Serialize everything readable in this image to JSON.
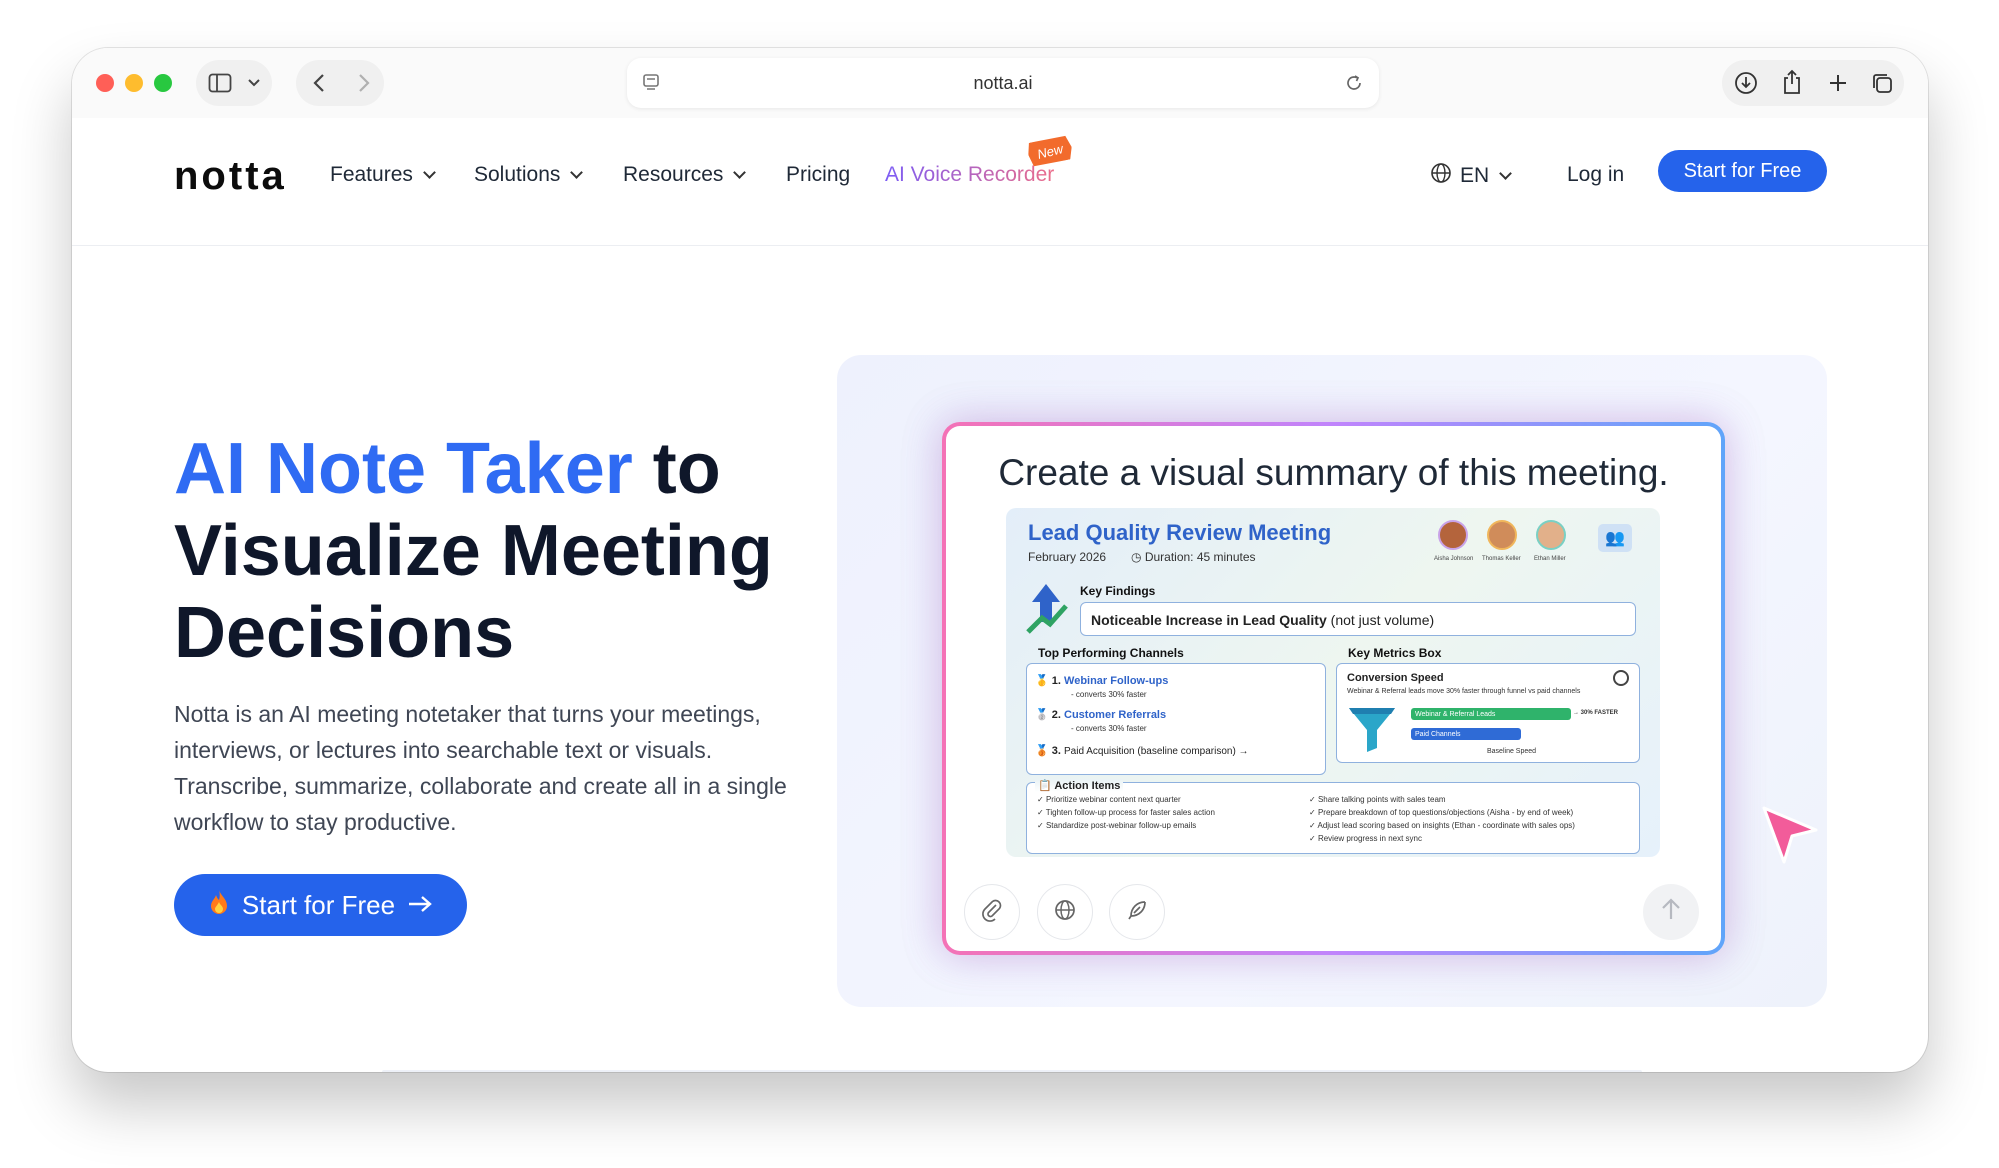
{
  "browser": {
    "url": "notta.ai",
    "colors": {
      "close": "#ff5f57",
      "minimize": "#febc2e",
      "zoom": "#28c840"
    },
    "icons": [
      "sidebar-icon",
      "chevron-down-icon",
      "back-icon",
      "forward-icon",
      "page-icon",
      "reload-icon",
      "download-icon",
      "share-icon",
      "new-tab-icon",
      "tab-overview-icon"
    ]
  },
  "nav": {
    "logo": "notta",
    "items": [
      {
        "label": "Features"
      },
      {
        "label": "Solutions"
      },
      {
        "label": "Resources"
      },
      {
        "label": "Pricing"
      }
    ],
    "voice_recorder": "AI Voice Recorder",
    "new_badge": "New",
    "language": "EN",
    "login": "Log in",
    "cta": "Start for Free",
    "accent": "#2563eb"
  },
  "hero": {
    "title_highlight": "AI Note Taker",
    "title_rest_1": " to",
    "title_line2": "Visualize Meeting",
    "title_line3": "Decisions",
    "description": "Notta is an AI meeting notetaker that turns your meetings, interviews, or lectures into searchable text or visuals. Transcribe, summarize, collaborate and create all in a single workflow to stay productive.",
    "cta": "Start for Free",
    "cta_icon": "fire-icon"
  },
  "demo": {
    "prompt": "Create a visual summary of this meeting.",
    "summary": {
      "title": "Lead Quality Review Meeting",
      "date": "February 2026",
      "duration": "Duration: 45 minutes",
      "attendees": [
        "Aisha Johnson",
        "Thomas Keller",
        "Ethan Miller"
      ],
      "key_findings_label": "Key Findings",
      "finding_bold": "Noticeable Increase in Lead Quality",
      "finding_rest": " (not just volume)",
      "channels_label": "Top Performing Channels",
      "channels": [
        {
          "rank": "1.",
          "name": "Webinar Follow-ups",
          "note": "- converts 30% faster"
        },
        {
          "rank": "2.",
          "name": "Customer Referrals",
          "note": "- converts 30% faster"
        },
        {
          "rank": "3.",
          "name": "Paid Acquisition (baseline comparison) →",
          "note": ""
        }
      ],
      "metrics_label": "Key Metrics Box",
      "metric_title": "Conversion Speed",
      "metric_desc": "Webinar & Referral leads move 30% faster through funnel vs paid channels",
      "bar1": "Webinar & Referral Leads",
      "bar1_tag": "→ 30% FASTER",
      "bar1_fraction": 0.9,
      "bar2": "Paid Channels",
      "bar2_fraction": 0.62,
      "baseline": "Baseline Speed",
      "actions_label": "Action Items",
      "actions_left": [
        "Prioritize webinar content next quarter",
        "Tighten follow-up process for faster sales action",
        "Standardize post-webinar follow-up emails"
      ],
      "actions_right": [
        "Share talking points with sales team",
        "Prepare breakdown of top questions/objections (Aisha - by end of week)",
        "Adjust lead scoring based on insights (Ethan - coordinate with sales ops)",
        "Review progress in next sync"
      ]
    },
    "tools": [
      "paperclip-icon",
      "globe-icon",
      "feather-icon"
    ],
    "send_icon": "arrow-up-icon"
  }
}
